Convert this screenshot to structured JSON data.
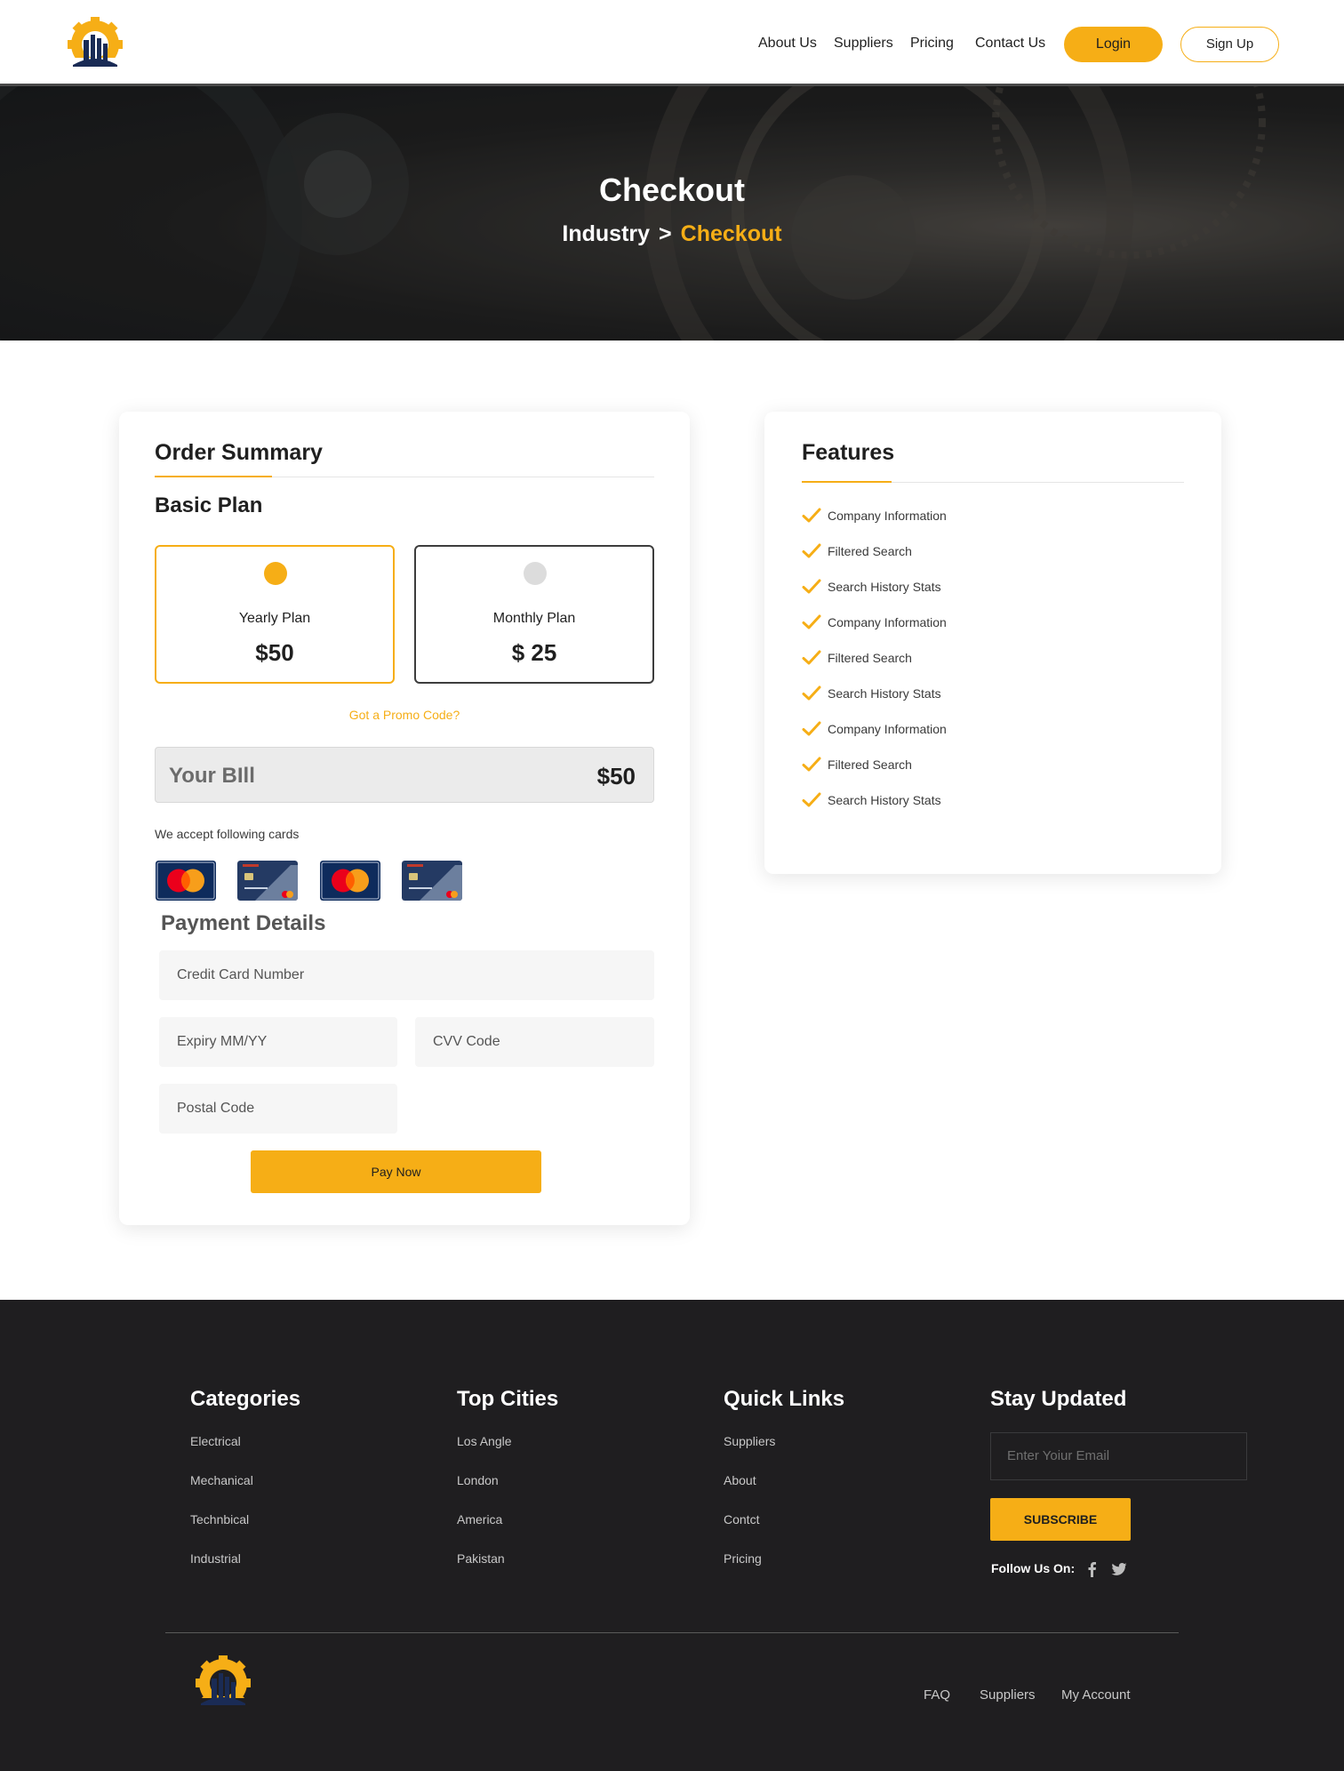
{
  "nav": {
    "links": [
      {
        "label": "About Us",
        "active": true
      },
      {
        "label": "Suppliers",
        "active": false
      },
      {
        "label": "Pricing",
        "active": false
      },
      {
        "label": "Contact Us",
        "active": false
      }
    ],
    "login_label": "Login",
    "signup_label": "Sign Up"
  },
  "hero": {
    "title": "Checkout",
    "breadcrumb": {
      "root": "Industry",
      "separator": ">",
      "current": "Checkout"
    }
  },
  "order": {
    "title": "Order Summary",
    "plan_heading": "Basic Plan",
    "plans": [
      {
        "name": "Yearly Plan",
        "price": "$50",
        "selected": true
      },
      {
        "name": "Monthly Plan",
        "price": "$ 25",
        "selected": false
      }
    ],
    "promo_label": "Got a Promo Code?",
    "bill": {
      "label": "Your BIll",
      "amount": "$50"
    },
    "accept_label": "We accept following cards",
    "card_icons": [
      "mastercard-icon",
      "bank-card-icon",
      "mastercard-icon",
      "bank-card-icon"
    ],
    "payment_heading": "Payment Details",
    "fields": {
      "card_number": "Credit Card Number",
      "expiry": "Expiry MM/YY",
      "cvv": "CVV Code",
      "postal": "Postal Code"
    },
    "pay_label": "Pay Now"
  },
  "features": {
    "title": "Features",
    "items": [
      "Company Information",
      "Filtered Search",
      "Search History Stats",
      "Company Information",
      "Filtered Search",
      "Search History Stats",
      "Company Information",
      "Filtered Search",
      "Search History Stats"
    ]
  },
  "footer": {
    "categories": {
      "heading": "Categories",
      "links": [
        "Electrical",
        "Mechanical",
        "Technbical",
        "Industrial"
      ]
    },
    "cities": {
      "heading": "Top Cities",
      "links": [
        "Los Angle",
        "London",
        "America",
        "Pakistan"
      ]
    },
    "quick": {
      "heading": "Quick Links",
      "links": [
        "Suppliers",
        "About",
        "Contct",
        "Pricing"
      ]
    },
    "updated": {
      "heading": "Stay Updated",
      "email_placeholder": "Enter Yoiur Email",
      "subscribe_label": "SUBSCRIBE",
      "follow_label": "Follow Us On:"
    },
    "bottom_links": [
      "FAQ",
      "Suppliers",
      "My Account"
    ]
  },
  "colors": {
    "accent": "#f6ae16",
    "dark": "#1f1e20",
    "logo_navy": "#1a2b55"
  }
}
